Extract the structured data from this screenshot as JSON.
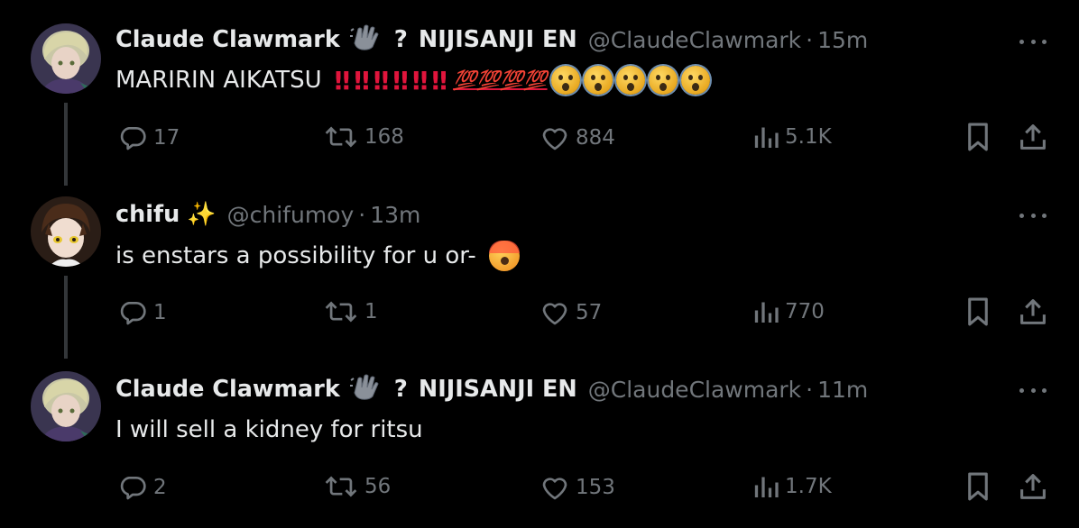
{
  "tweets": [
    {
      "name": "Claude Clawmark",
      "badge_emoji_name": "waving-hand-gray",
      "qmark": "?",
      "org": "NIJISANJI EN",
      "handle": "@ClaudeClawmark",
      "separator": "·",
      "time": "15m",
      "text": "MARIRIN AIKATSU",
      "text_bangs": "‼‼‼‼‼‼",
      "text_hundreds": "💯💯💯💯",
      "replies": "17",
      "retweets": "168",
      "likes": "884",
      "views": "5.1K"
    },
    {
      "name": "chifu",
      "sparkle": "✨",
      "handle": "@chifumoy",
      "separator": "·",
      "time": "13m",
      "text": "is enstars a possibility for u or-",
      "replies": "1",
      "retweets": "1",
      "likes": "57",
      "views": "770"
    },
    {
      "name": "Claude Clawmark",
      "badge_emoji_name": "waving-hand-gray",
      "qmark": "?",
      "org": "NIJISANJI EN",
      "handle": "@ClaudeClawmark",
      "separator": "·",
      "time": "11m",
      "text": "I will sell a kidney for ritsu",
      "replies": "2",
      "retweets": "56",
      "likes": "153",
      "views": "1.7K"
    }
  ],
  "colors": {
    "background": "#000000",
    "text": "#e7e9ea",
    "muted": "#71767b",
    "thread_line": "#333639"
  }
}
